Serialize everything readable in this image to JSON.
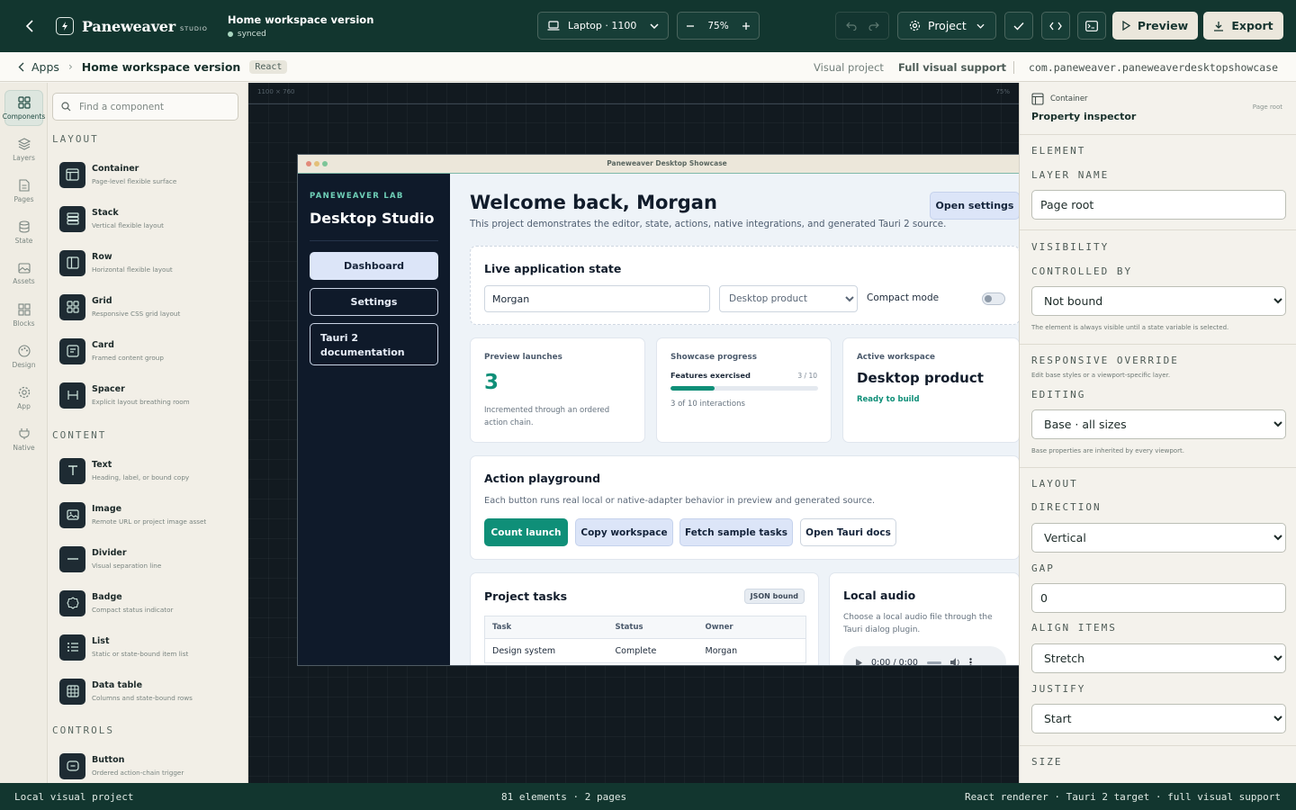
{
  "topbar": {
    "brand": "Paneweaver",
    "brand_suffix": "STUDIO",
    "doc_title": "Home workspace version",
    "doc_status": "synced",
    "device": "Laptop · 1100",
    "zoom": "75%",
    "project_label": "Project",
    "preview_label": "Preview",
    "export_label": "Export"
  },
  "breadcrumb": {
    "parent": "Apps",
    "current": "Home workspace version",
    "framework_badge": "React",
    "project_type": "Visual project",
    "support": "Full visual support",
    "package_id": "com.paneweaver.paneweaverdesktopshowcase"
  },
  "rail": {
    "items": [
      {
        "label": "Components",
        "icon": "grid-icon"
      },
      {
        "label": "Layers",
        "icon": "layers-icon"
      },
      {
        "label": "Pages",
        "icon": "page-icon"
      },
      {
        "label": "State",
        "icon": "database-icon"
      },
      {
        "label": "Assets",
        "icon": "image-icon"
      },
      {
        "label": "Blocks",
        "icon": "blocks-icon"
      },
      {
        "label": "Design",
        "icon": "palette-icon"
      },
      {
        "label": "App",
        "icon": "gear-icon"
      },
      {
        "label": "Native",
        "icon": "plug-icon"
      }
    ]
  },
  "palette": {
    "search_placeholder": "Find a component",
    "layout_heading": "LAYOUT",
    "content_heading": "CONTENT",
    "controls_heading": "CONTROLS",
    "layout": [
      {
        "name": "Container",
        "desc": "Page-level flexible surface"
      },
      {
        "name": "Stack",
        "desc": "Vertical flexible layout"
      },
      {
        "name": "Row",
        "desc": "Horizontal flexible layout"
      },
      {
        "name": "Grid",
        "desc": "Responsive CSS grid layout"
      },
      {
        "name": "Card",
        "desc": "Framed content group"
      },
      {
        "name": "Spacer",
        "desc": "Explicit layout breathing room"
      }
    ],
    "content": [
      {
        "name": "Text",
        "desc": "Heading, label, or bound copy"
      },
      {
        "name": "Image",
        "desc": "Remote URL or project image asset"
      },
      {
        "name": "Divider",
        "desc": "Visual separation line"
      },
      {
        "name": "Badge",
        "desc": "Compact status indicator"
      },
      {
        "name": "List",
        "desc": "Static or state-bound item list"
      },
      {
        "name": "Data table",
        "desc": "Columns and state-bound rows"
      }
    ],
    "controls": [
      {
        "name": "Button",
        "desc": "Ordered action-chain trigger"
      }
    ]
  },
  "canvas": {
    "dimensions": "1100 × 760",
    "zoom": "75%"
  },
  "frame": {
    "title": "Paneweaver Desktop Showcase",
    "kicker": "PANEWEAVER LAB",
    "app_name": "Desktop Studio",
    "nav": [
      "Dashboard",
      "Settings",
      "Tauri 2 documentation"
    ],
    "welcome": "Welcome back, Morgan",
    "welcome_sub": "This project demonstrates the editor, state, actions, native integrations, and generated Tauri 2 source.",
    "open_settings": "Open settings",
    "live": {
      "heading": "Live application state",
      "name_value": "Morgan",
      "product_option": "Desktop product",
      "compact_label": "Compact mode"
    },
    "stats": {
      "launches_label": "Preview launches",
      "launches_value": "3",
      "launches_note": "Incremented through an ordered action chain.",
      "progress_label": "Showcase progress",
      "progress_sub": "Features exercised",
      "progress_count": "3 / 10",
      "progress_fraction": 0.3,
      "progress_note": "3 of 10 interactions",
      "workspace_label": "Active workspace",
      "workspace_value": "Desktop product",
      "workspace_status": "Ready to build"
    },
    "playground": {
      "heading": "Action playground",
      "desc": "Each button runs real local or native-adapter behavior in preview and generated source.",
      "buttons": [
        "Count launch",
        "Copy workspace",
        "Fetch sample tasks",
        "Open Tauri docs"
      ]
    },
    "tasks": {
      "heading": "Project tasks",
      "badge": "JSON bound",
      "columns": [
        "Task",
        "Status",
        "Owner"
      ],
      "rows": [
        [
          "Design system",
          "Complete",
          "Morgan"
        ]
      ]
    },
    "audio": {
      "heading": "Local audio",
      "desc": "Choose a local audio file through the Tauri dialog plugin.",
      "time": "0:00 / 0:00"
    }
  },
  "inspector": {
    "kind": "Container",
    "title": "Property inspector",
    "target": "Page root",
    "element_heading": "ELEMENT",
    "layer_name_label": "LAYER NAME",
    "layer_name": "Page root",
    "visibility_heading": "VISIBILITY",
    "controlled_by_label": "CONTROLLED BY",
    "controlled_by": "Not bound",
    "visibility_note": "The element is always visible until a state variable is selected.",
    "responsive_heading": "RESPONSIVE OVERRIDE",
    "responsive_note": "Edit base styles or a viewport-specific layer.",
    "editing_label": "EDITING",
    "editing": "Base · all sizes",
    "editing_note": "Base properties are inherited by every viewport.",
    "layout_heading": "LAYOUT",
    "direction_label": "DIRECTION",
    "direction": "Vertical",
    "gap_label": "GAP",
    "gap": "0",
    "align_label": "ALIGN ITEMS",
    "align": "Stretch",
    "justify_label": "JUSTIFY",
    "justify": "Start",
    "size_heading": "SIZE"
  },
  "statusbar": {
    "left": "Local visual project",
    "middle": "81 elements · 2 pages",
    "right": "React renderer · Tauri 2 target · full visual support"
  },
  "colors": {
    "chrome": "#12362f",
    "accent": "#0f8f78",
    "app_sidebar": "#0f1a2a",
    "canvas": "#121a20"
  }
}
